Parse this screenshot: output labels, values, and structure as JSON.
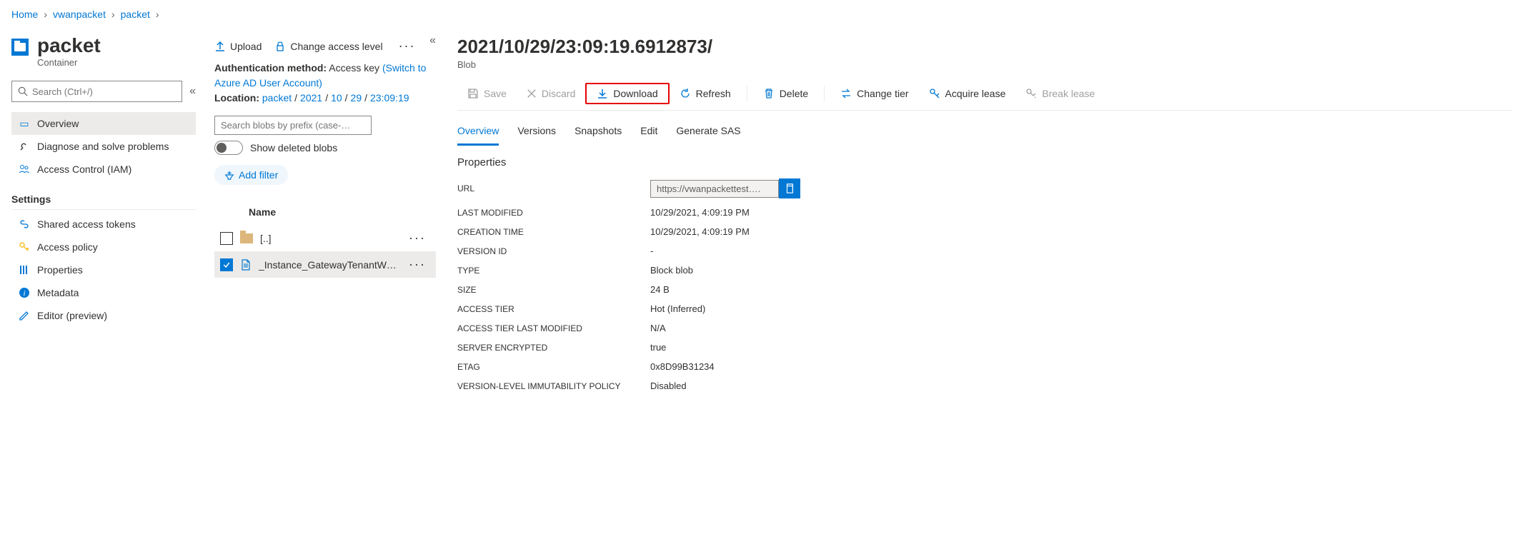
{
  "breadcrumb": [
    "Home",
    "vwanpacket",
    "packet"
  ],
  "page": {
    "title": "packet",
    "subtitle": "Container"
  },
  "search": {
    "placeholder": "Search (Ctrl+/)"
  },
  "nav": {
    "items": [
      {
        "label": "Overview"
      },
      {
        "label": "Diagnose and solve problems"
      },
      {
        "label": "Access Control (IAM)"
      }
    ],
    "settings_header": "Settings",
    "settings": [
      {
        "label": "Shared access tokens"
      },
      {
        "label": "Access policy"
      },
      {
        "label": "Properties"
      },
      {
        "label": "Metadata"
      },
      {
        "label": "Editor (preview)"
      }
    ]
  },
  "center_toolbar": {
    "upload": "Upload",
    "change_access": "Change access level"
  },
  "auth": {
    "label": "Authentication method:",
    "value": "Access key",
    "switch_link": "(Switch to Azure AD User Account)",
    "location_label": "Location:",
    "location_parts": [
      "packet",
      "2021",
      "10",
      "29",
      "23:09:19"
    ]
  },
  "blob_search_placeholder": "Search blobs by prefix (case-…",
  "show_deleted": "Show deleted blobs",
  "add_filter": "Add filter",
  "table": {
    "header_name": "Name",
    "rows": [
      {
        "name": "[..]",
        "type": "folder",
        "selected": false
      },
      {
        "name": "_Instance_GatewayTenantWor…",
        "type": "file",
        "selected": true
      }
    ]
  },
  "blob": {
    "title": "2021/10/29/23:09:19.6912873/",
    "subtitle": "Blob"
  },
  "right_toolbar": {
    "save": "Save",
    "discard": "Discard",
    "download": "Download",
    "refresh": "Refresh",
    "delete": "Delete",
    "change_tier": "Change tier",
    "acquire_lease": "Acquire lease",
    "break_lease": "Break lease"
  },
  "tabs": [
    "Overview",
    "Versions",
    "Snapshots",
    "Edit",
    "Generate SAS"
  ],
  "properties_title": "Properties",
  "properties": [
    {
      "key": "URL",
      "value": "https://vwanpackettest….",
      "is_url": true
    },
    {
      "key": "LAST MODIFIED",
      "value": "10/29/2021, 4:09:19 PM"
    },
    {
      "key": "CREATION TIME",
      "value": "10/29/2021, 4:09:19 PM"
    },
    {
      "key": "VERSION ID",
      "value": "-"
    },
    {
      "key": "TYPE",
      "value": "Block blob"
    },
    {
      "key": "SIZE",
      "value": "24 B"
    },
    {
      "key": "ACCESS TIER",
      "value": "Hot (Inferred)"
    },
    {
      "key": "ACCESS TIER LAST MODIFIED",
      "value": "N/A"
    },
    {
      "key": "SERVER ENCRYPTED",
      "value": "true"
    },
    {
      "key": "ETAG",
      "value": "0x8D99B31234"
    },
    {
      "key": "VERSION-LEVEL IMMUTABILITY POLICY",
      "value": "Disabled"
    }
  ]
}
